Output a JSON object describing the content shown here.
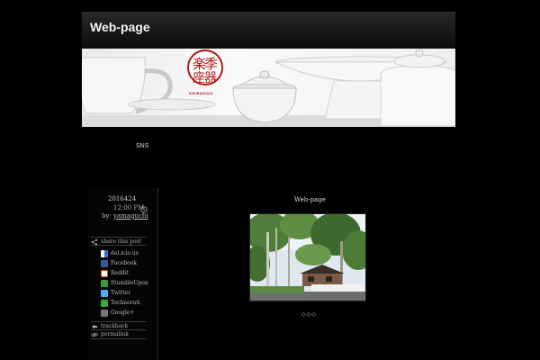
{
  "site": {
    "title": "Web-page"
  },
  "banner": {
    "logo_caption": "KIKIRAKUZA"
  },
  "sns": {
    "label": "SNS"
  },
  "post": {
    "date": "2016424",
    "time": "12:00 PM",
    "by_label": "by:",
    "author": "yamaguchi",
    "title": "Web-page",
    "image_caption": "◇◇◇"
  },
  "share": {
    "label": "share this post",
    "items": [
      {
        "label": "del.icio.us",
        "color": "#3274d0"
      },
      {
        "label": "Facebook",
        "color": "#3b5998"
      },
      {
        "label": "Reddit",
        "color": "#ff4500"
      },
      {
        "label": "StumbleUpon",
        "color": "#eb4924"
      },
      {
        "label": "Twitter",
        "color": "#55acee"
      },
      {
        "label": "Technorati",
        "color": "#3ca63c"
      },
      {
        "label": "Google+",
        "color": "#dd4b39"
      }
    ]
  },
  "links": {
    "trackback": "trackback",
    "permalink": "permalink"
  }
}
